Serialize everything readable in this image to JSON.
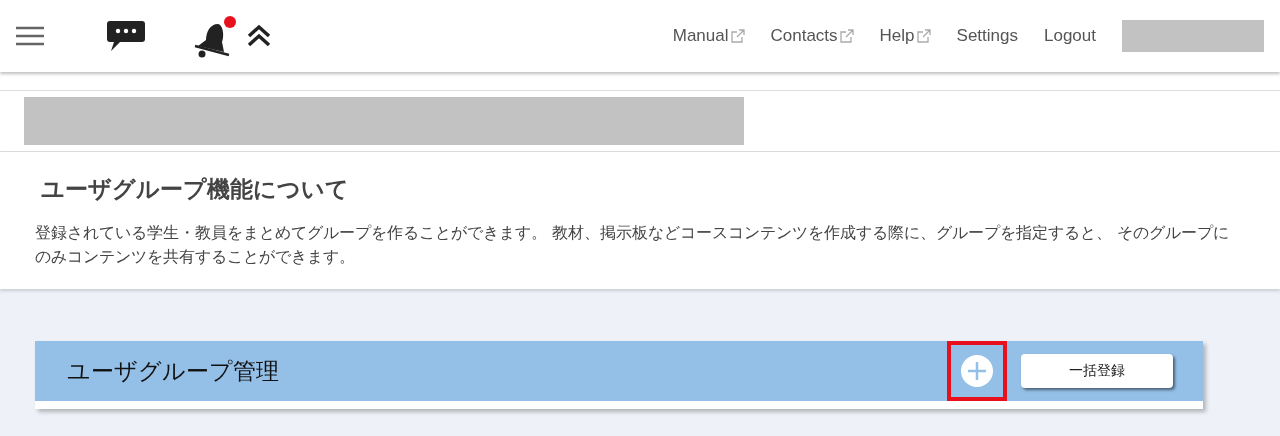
{
  "header": {
    "notification": true,
    "links": [
      {
        "label": "Manual",
        "external": true
      },
      {
        "label": "Contacts",
        "external": true
      },
      {
        "label": "Help",
        "external": true
      },
      {
        "label": "Settings",
        "external": false
      },
      {
        "label": "Logout",
        "external": false
      }
    ]
  },
  "info": {
    "title": "ユーザグループ機能について",
    "description": "登録されている学生・教員をまとめてグループを作ることができます。 教材、掲示板などコースコンテンツを作成する際に、グループを指定すると、 そのグループにのみコンテンツを共有することができます。"
  },
  "panel": {
    "title": "ユーザグループ管理",
    "add_button": {
      "highlighted": true
    },
    "bulk_button": "一括登録"
  }
}
